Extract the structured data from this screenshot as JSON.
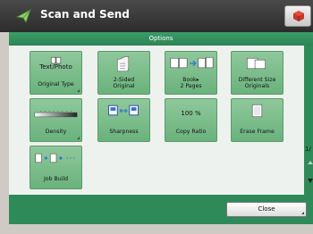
{
  "header": {
    "title": "Scan and Send",
    "app_icon": "send-arrow-icon",
    "menu_icon": "cube-icon"
  },
  "panel": {
    "title": "Options"
  },
  "tiles": {
    "original_type": {
      "value": "Text/Photo",
      "label": "Original Type"
    },
    "two_sided": {
      "label_line1": "2-Sided",
      "label_line2": "Original"
    },
    "book_two_pages": {
      "label_line1": "Book▸",
      "label_line2": "2 Pages"
    },
    "different_size": {
      "label_line1": "Different Size",
      "label_line2": "Originals"
    },
    "density": {
      "label": "Density"
    },
    "sharpness": {
      "label": "Sharpness"
    },
    "copy_ratio": {
      "value": "100 %",
      "label": "Copy Ratio"
    },
    "erase_frame": {
      "label": "Erase Frame"
    },
    "job_build": {
      "label": "Job Build"
    }
  },
  "pager": {
    "indicator": "1/"
  },
  "footer": {
    "close_label": "Close"
  },
  "colors": {
    "panel_green": "#2f8a5a",
    "tile_green": "#7bbd8a",
    "header_dark": "#333333"
  }
}
